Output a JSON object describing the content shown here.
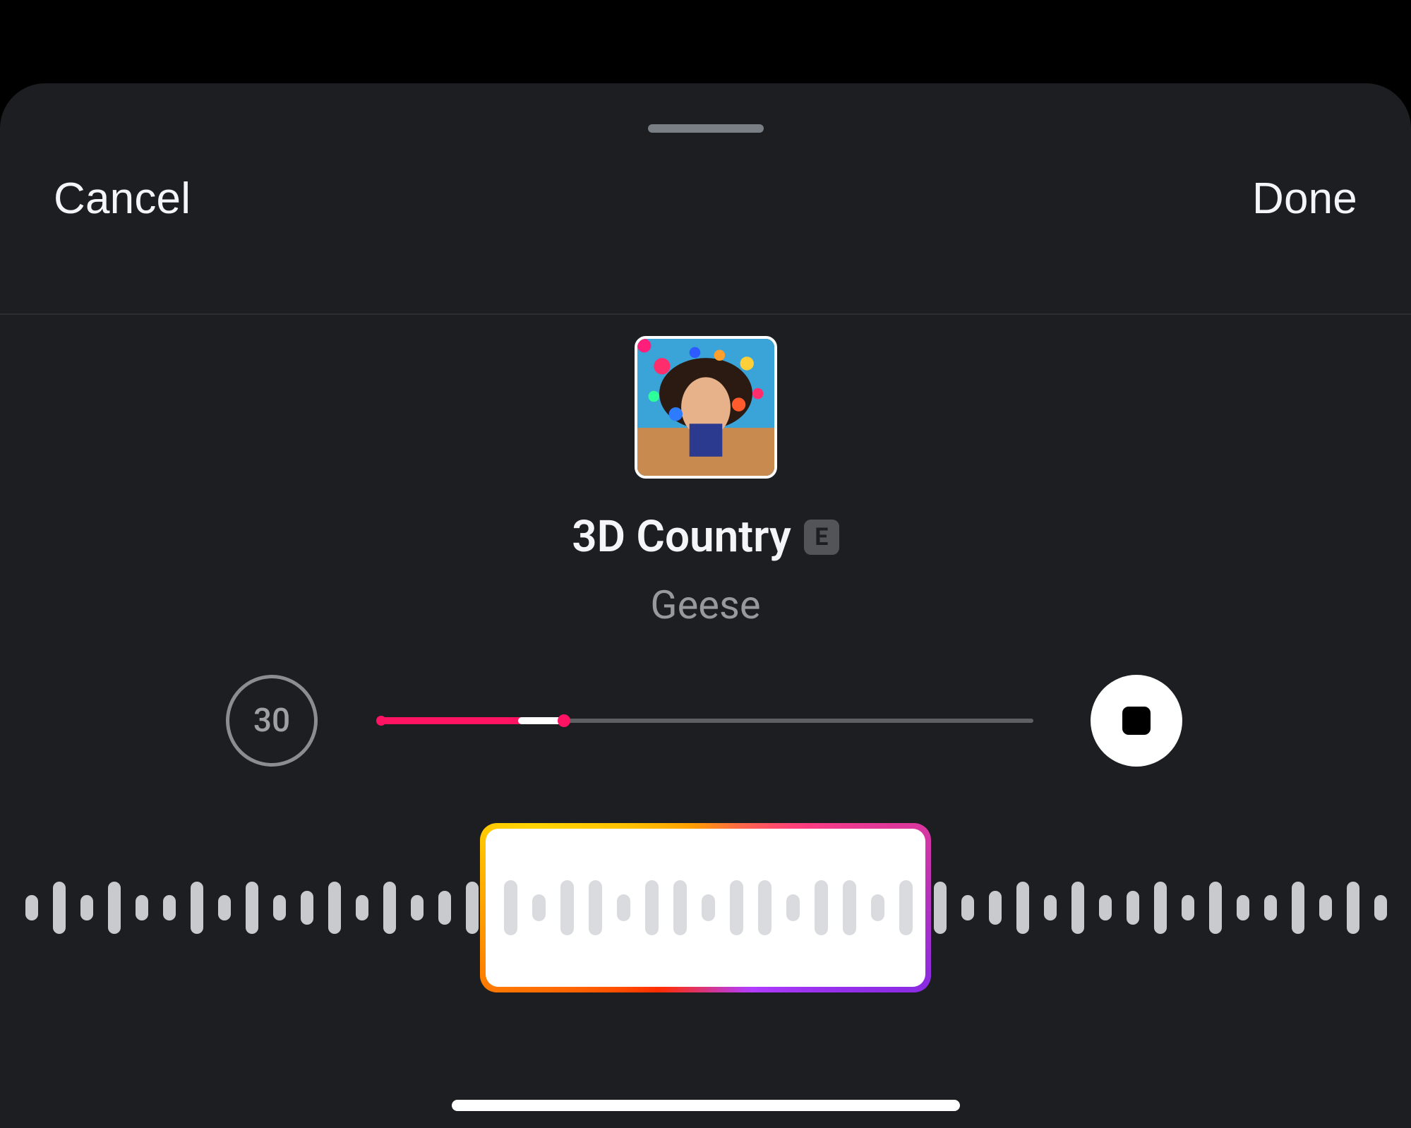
{
  "header": {
    "cancel_label": "Cancel",
    "done_label": "Done"
  },
  "track": {
    "title": "3D Country",
    "artist": "Geese",
    "explicit_badge": "E"
  },
  "playback": {
    "clip_duration": "30",
    "selection_start_pct": 0,
    "selection_end_pct": 28,
    "played_start_pct": 21,
    "played_end_pct": 28
  },
  "scrubber": {
    "selection_left_pct": 34,
    "selection_width_pct": 32,
    "outer_bar_heights": [
      36,
      74,
      36,
      74,
      36,
      36,
      74,
      36,
      74,
      36,
      48,
      74,
      36,
      74,
      36,
      48,
      74,
      36,
      74,
      36,
      48,
      74,
      36,
      74,
      36,
      36,
      74,
      36,
      74,
      36,
      48,
      74,
      36,
      74,
      36,
      48,
      74,
      36,
      74,
      36,
      48,
      74,
      36,
      74,
      36,
      36,
      74,
      36,
      74,
      36
    ],
    "window_bar_heights": [
      78,
      38,
      78,
      78,
      38,
      78,
      78,
      38,
      78,
      78,
      38,
      78,
      78,
      38,
      78,
      78
    ]
  }
}
